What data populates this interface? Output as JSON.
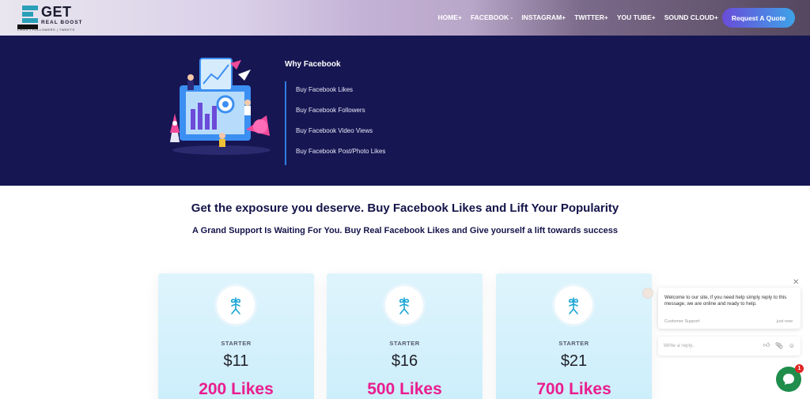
{
  "header": {
    "logo": {
      "main": "GET",
      "sub": "REAL BOOST",
      "tagline": "LIKES | FOLLOWERS | TWEETS"
    },
    "nav": [
      "HOME+",
      "FACEBOOK -",
      "INSTAGRAM+",
      "TWITTER+",
      "YOU TUBE+",
      "SOUND CLOUD+"
    ],
    "cta": "Request A Quote"
  },
  "why": {
    "title": "Why Facebook",
    "links": [
      "Buy Facebook Likes",
      "Buy Facebook Followers",
      "Buy Facebook Video Views",
      "Buy Facebook Post/Photo Likes"
    ]
  },
  "headline": "Get the exposure you deserve. Buy Facebook Likes and Lift Your Popularity",
  "subheadline": "A Grand Support Is Waiting For You. Buy Real Facebook Likes and Give yourself a lift towards success",
  "cards": [
    {
      "tier": "STARTER",
      "price": "$11",
      "likes": "200 Likes"
    },
    {
      "tier": "STARTER",
      "price": "$16",
      "likes": "500 Likes"
    },
    {
      "tier": "STARTER",
      "price": "$21",
      "likes": "700 Likes"
    }
  ],
  "chat": {
    "message": "Welcome to our site, if you need help simply reply to this message, we are online and ready to help.",
    "from": "Customer Support",
    "time": "just now",
    "placeholder": "Write a reply..",
    "badge": "1"
  },
  "colors": {
    "navy": "#161653",
    "accent_pink": "#ea1d8e",
    "link_blue": "#2f7de0",
    "chat_green": "#1f8d4b"
  }
}
